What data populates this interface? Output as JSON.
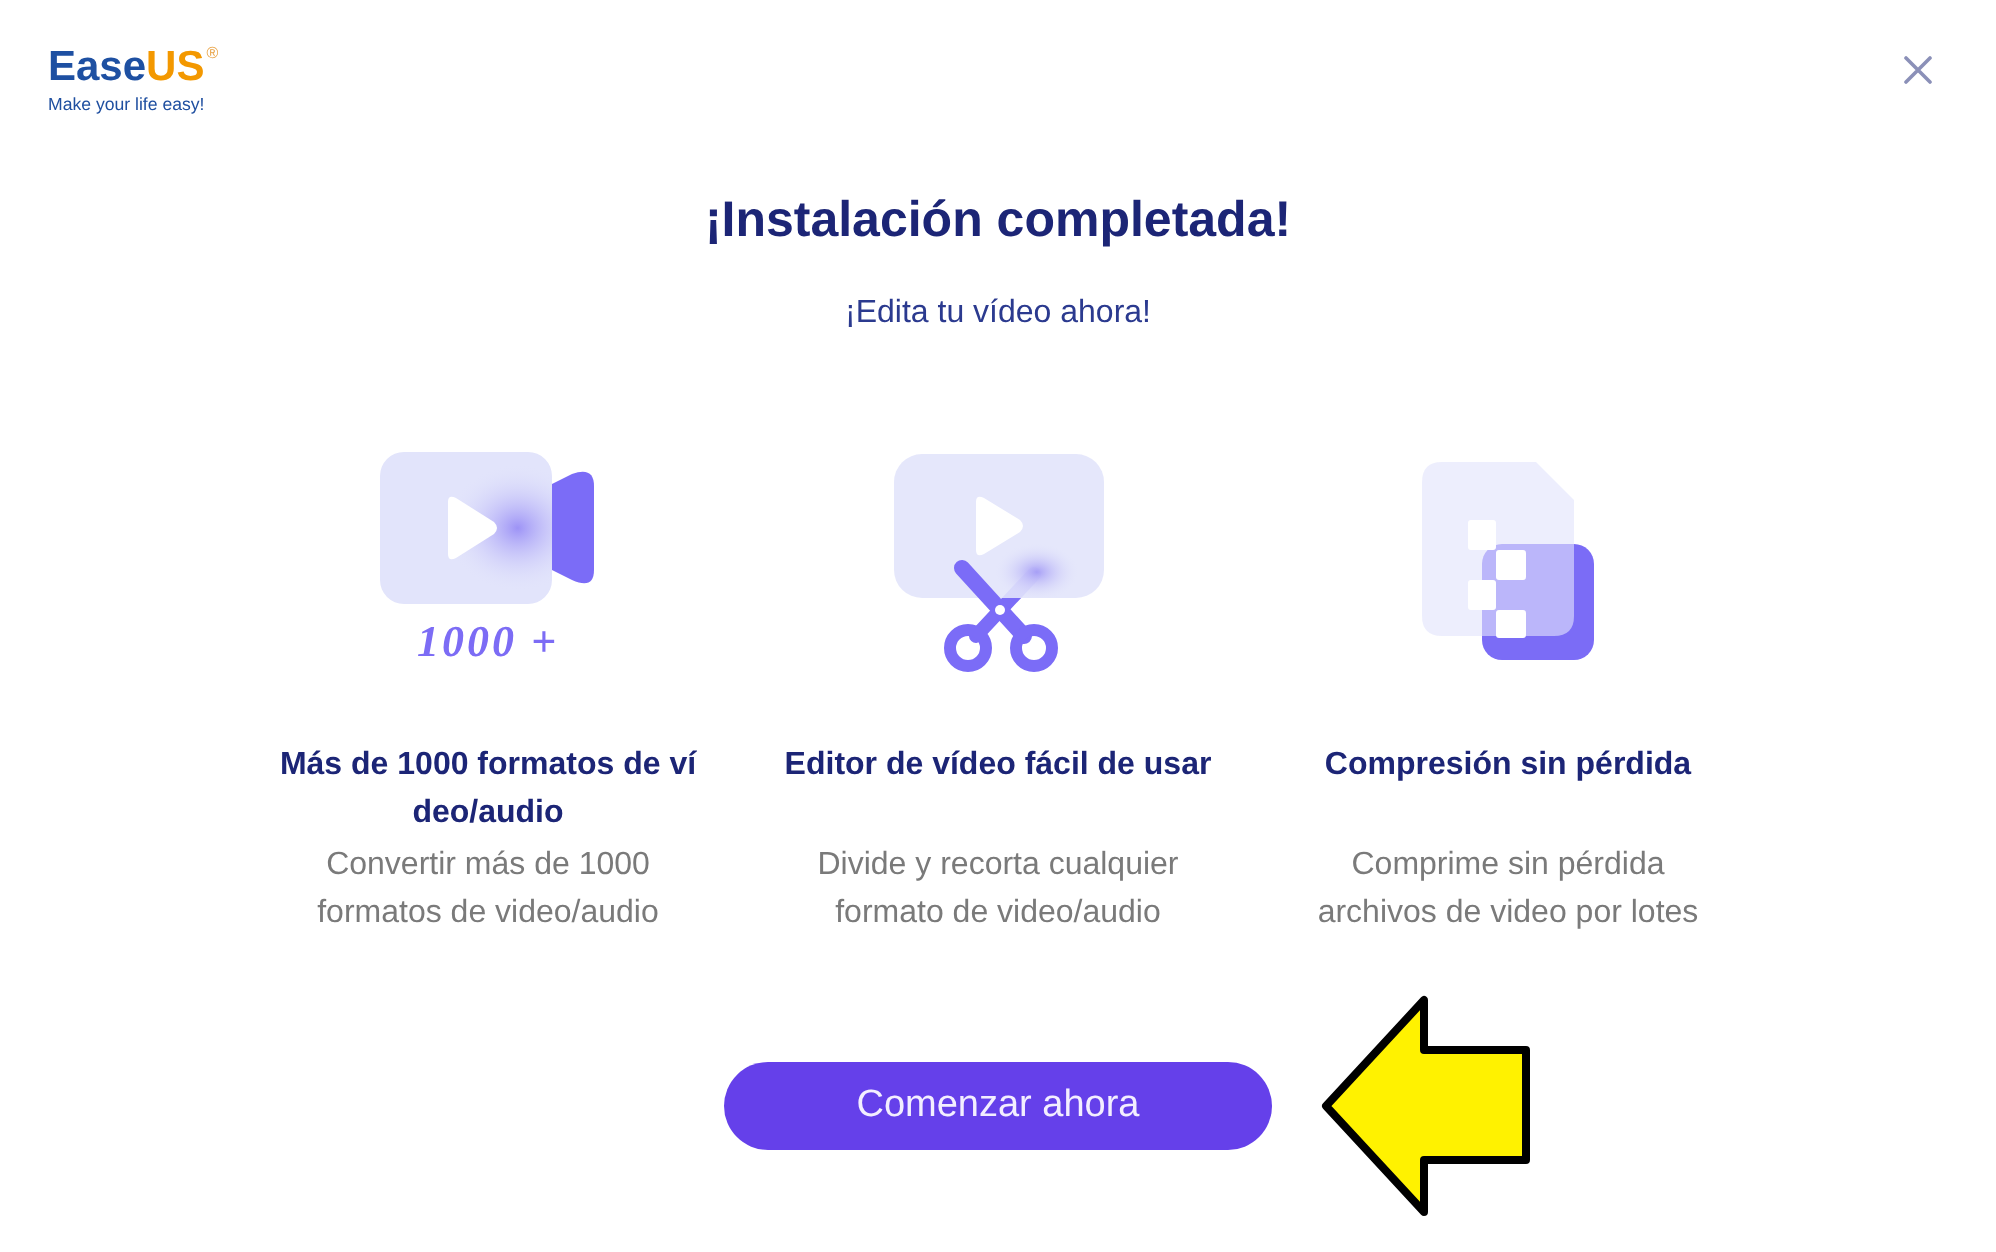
{
  "logo": {
    "wordmark_first": "Ease",
    "wordmark_second": "US",
    "registered": "®",
    "tagline": "Make your life easy!"
  },
  "heading": {
    "title": "¡Instalación completada!",
    "subtitle": "¡Edita tu vídeo ahora!"
  },
  "features": [
    {
      "kind": "convert",
      "badge": "1000 +",
      "title": "Más de 1000 formatos de vídeo/audio",
      "description": "Convertir más de 1000 formatos de video/audio"
    },
    {
      "kind": "edit",
      "title": "Editor de vídeo fácil de usar",
      "description": "Divide y recorta cualquier formato de video/audio"
    },
    {
      "kind": "compress",
      "title": "Compresión sin pérdida",
      "description": "Comprime sin pérdida archivos de video por lotes"
    }
  ],
  "primary_button": {
    "label": "Comenzar ahora"
  }
}
